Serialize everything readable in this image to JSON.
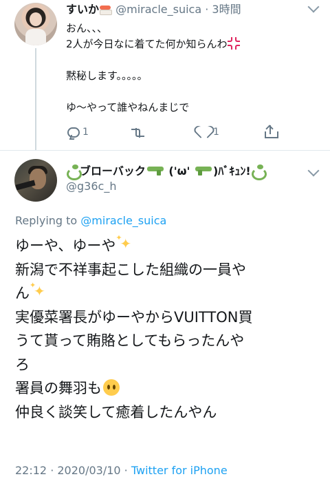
{
  "parent_tweet": {
    "display_name": "すいか",
    "handle": "@miracle_suica",
    "separator": " · ",
    "time_ago": "3時間",
    "text_line1": "おん、、、",
    "text_line2": "2人が今日なに着てた何か知らんわ",
    "text_line3": "",
    "text_line4": "黙秘します。。。。。",
    "text_line5": "",
    "text_line6": "ゆ〜やって誰やねんまじで",
    "reply_count": "1",
    "retweet_count": "",
    "like_count": "1"
  },
  "reply_tweet": {
    "display_name_a": "ブローバック",
    "display_name_b": " ('ω' ",
    "display_name_c": ")ﾊﾞｷｭﾝ!",
    "handle": "@g36c_h",
    "replying_prefix": "Replying to ",
    "replying_handle": "@miracle_suica",
    "line1": "ゆーや、ゆーや",
    "line2": "新潟で不祥事起こした組織の一員や",
    "line3": "ん",
    "line4": "実優菜署長がゆーやからVUITTON買",
    "line5": "うて貰って賄賂としてもらったんや",
    "line6": "ろ",
    "line7": "署員の舞羽も",
    "line8": "仲良く談笑して癒着したんやん",
    "time": "22:12",
    "sep": " · ",
    "date": "2020/03/10",
    "sep2": " · ",
    "source": "Twitter for iPhone"
  },
  "colors": {
    "text": "#14171a",
    "secondary": "#657786",
    "link": "#1da1f2",
    "divider": "#e1e8ed"
  }
}
